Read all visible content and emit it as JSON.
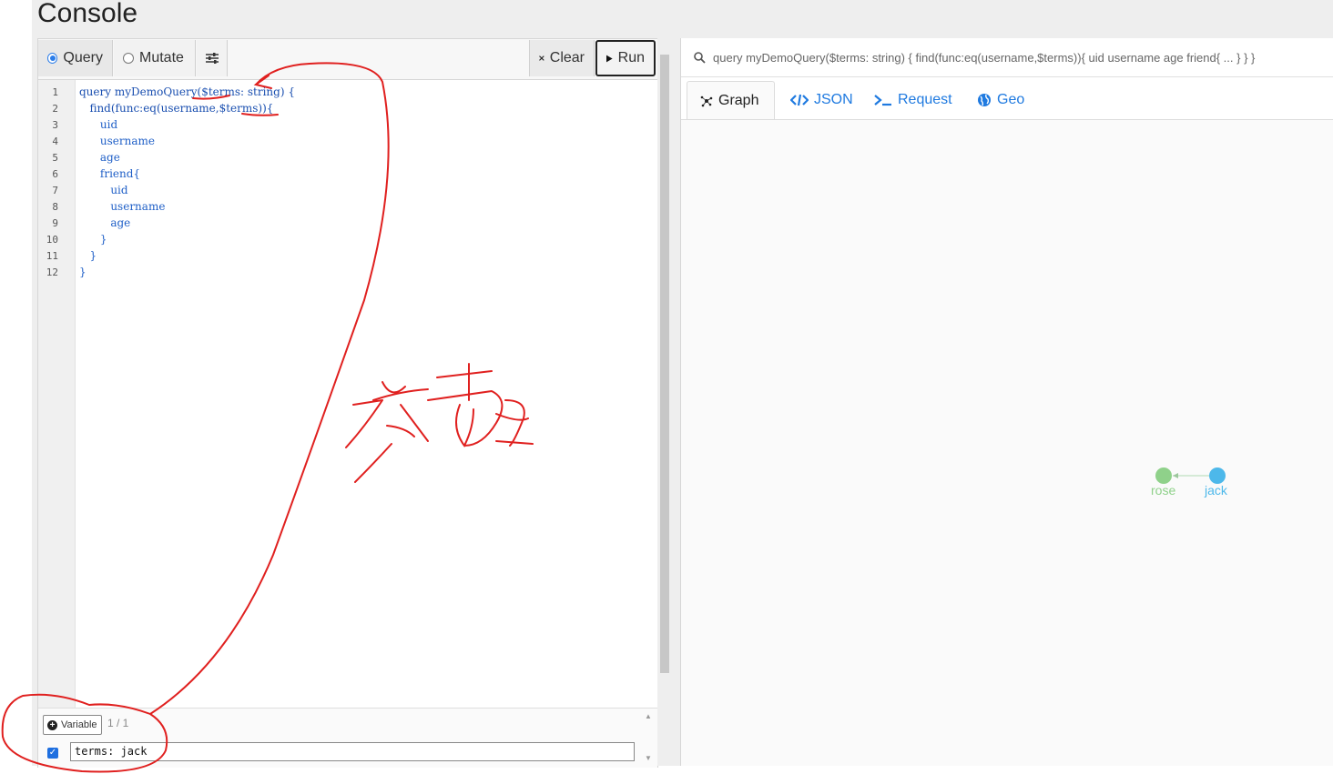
{
  "page": {
    "title": "Console"
  },
  "toolbar": {
    "query_label": "Query",
    "mutate_label": "Mutate",
    "selected_mode": "Query",
    "clear_label": "Clear",
    "run_label": "Run"
  },
  "editor": {
    "line_numbers": [
      "1",
      "2",
      "3",
      "4",
      "5",
      "6",
      "7",
      "8",
      "9",
      "10",
      "11",
      "12"
    ],
    "lines": [
      "query myDemoQuery($terms: string) {",
      "   find(func:eq(username,$terms)){",
      "      uid",
      "      username",
      "      age",
      "      friend{",
      "         uid",
      "         username",
      "         age",
      "      }",
      "   }",
      "}"
    ]
  },
  "variables": {
    "add_label": "Variable",
    "count": "1 / 1",
    "checked": true,
    "value": "terms: jack"
  },
  "result": {
    "query_summary": "query myDemoQuery($terms: string) { find(func:eq(username,$terms)){ uid username age friend{ ... } } }",
    "tabs": [
      {
        "label": "Graph",
        "icon": "graph-icon",
        "active": true
      },
      {
        "label": "JSON",
        "icon": "code-icon",
        "active": false
      },
      {
        "label": "Request",
        "icon": "terminal-icon",
        "active": false
      },
      {
        "label": "Geo",
        "icon": "globe-icon",
        "active": false
      }
    ],
    "graph": {
      "nodes": [
        {
          "label": "rose",
          "color": "#8fd18a"
        },
        {
          "label": "jack",
          "color": "#4db8ea"
        }
      ],
      "edges": [
        {
          "from": "jack",
          "to": "rose"
        }
      ]
    }
  },
  "annotation": {
    "handwritten_text": "参数",
    "color": "#e0201f"
  }
}
